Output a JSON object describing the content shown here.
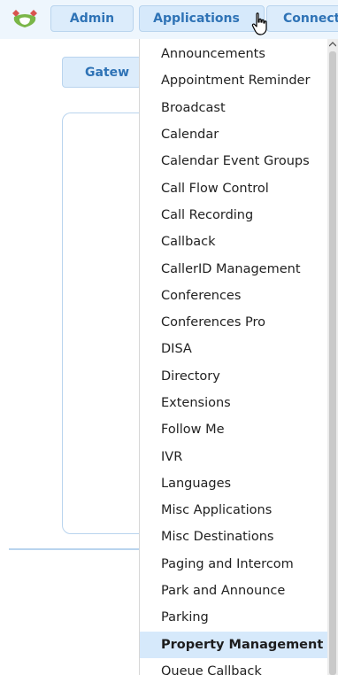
{
  "topbar": {
    "admin_label": "Admin",
    "applications_label": "Applications",
    "connect_label": "Connect"
  },
  "content": {
    "gateway_label": "Gatew"
  },
  "dropdown": {
    "items": [
      "Announcements",
      "Appointment Reminder",
      "Broadcast",
      "Calendar",
      "Calendar Event Groups",
      "Call Flow Control",
      "Call Recording",
      "Callback",
      "CallerID Management",
      "Conferences",
      "Conferences Pro",
      "DISA",
      "Directory",
      "Extensions",
      "Follow Me",
      "IVR",
      "Languages",
      "Misc Applications",
      "Misc Destinations",
      "Paging and Intercom",
      "Park and Announce",
      "Parking",
      "Property Management",
      "Queue Callback"
    ],
    "selected": "Property Management"
  },
  "icons": {
    "logo": "freepbx-logo-icon",
    "cursor": "hand-pointer-icon",
    "scroll_up": "chevron-up-icon"
  },
  "colors": {
    "accent_text": "#2f73b6",
    "button_bg": "#dcecfb",
    "topbar_bg": "#eef6fd",
    "selected_bg": "#d6e9fb"
  }
}
